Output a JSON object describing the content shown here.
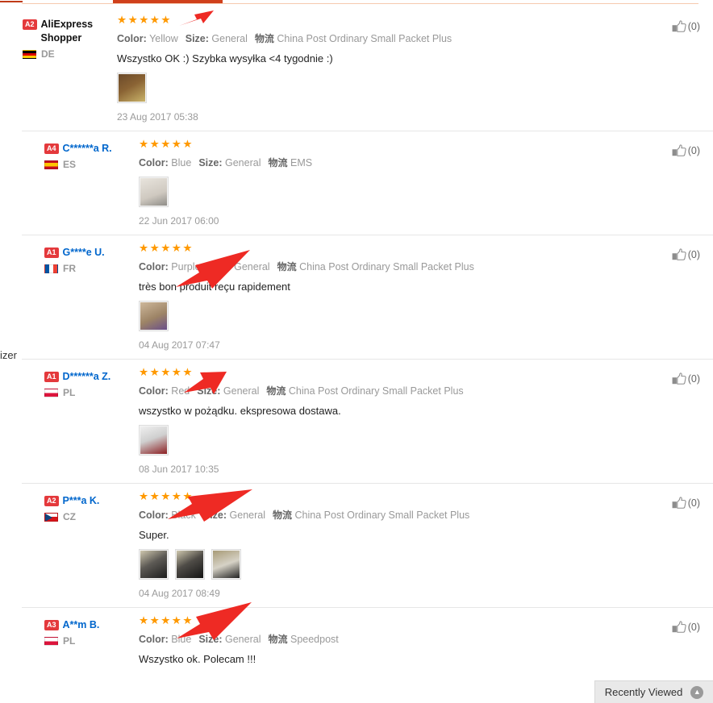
{
  "page": {
    "stray_text": "izer",
    "helpful_icon": "thumbs-up-icon"
  },
  "recently_viewed": {
    "label": "Recently Viewed",
    "chevron": "chevron-up-icon"
  },
  "attr_labels": {
    "color": "Color:",
    "size": "Size:",
    "logistics": "物流"
  },
  "reviews": [
    {
      "level": "A2",
      "name": "AliExpress Shopper",
      "name_color": "black",
      "country_code": "DE",
      "flag": "flag-de",
      "stars": "★★★★★",
      "rating": 5,
      "color": "Yellow",
      "size": "General",
      "shipping": "China Post Ordinary Small Packet Plus",
      "text": "Wszystko OK :) Szybka wysyłka <4 tygodnie :)",
      "date": "23 Aug 2017 05:38",
      "helpful_count": "(0)",
      "thumbs": [
        "yellow-shoes-photo"
      ]
    },
    {
      "level": "A4",
      "name": "C******a R.",
      "name_color": "blue",
      "country_code": "ES",
      "flag": "flag-es",
      "stars": "★★★★★",
      "rating": 5,
      "color": "Blue",
      "size": "General",
      "shipping": "EMS",
      "text": "",
      "date": "22 Jun 2017 06:00",
      "helpful_count": "(0)",
      "thumbs": [
        "blue-item-photo"
      ]
    },
    {
      "level": "A1",
      "name": "G****e U.",
      "name_color": "blue",
      "country_code": "FR",
      "flag": "flag-fr",
      "stars": "★★★★★",
      "rating": 5,
      "color": "Purple",
      "size": "General",
      "shipping": "China Post Ordinary Small Packet Plus",
      "text": "très bon produit reçu rapidement",
      "date": "04 Aug 2017 07:47",
      "helpful_count": "(0)",
      "thumbs": [
        "purple-item-photo"
      ]
    },
    {
      "level": "A1",
      "name": "D******a Z.",
      "name_color": "blue",
      "country_code": "PL",
      "flag": "flag-pl",
      "stars": "★★★★★",
      "rating": 5,
      "color": "Red",
      "size": "General",
      "shipping": "China Post Ordinary Small Packet Plus",
      "text": "wszystko w pożądku. ekspresowa dostawa.",
      "date": "08 Jun 2017 10:35",
      "helpful_count": "(0)",
      "thumbs": [
        "red-item-photo"
      ]
    },
    {
      "level": "A2",
      "name": "P***a K.",
      "name_color": "blue",
      "country_code": "CZ",
      "flag": "flag-cz",
      "stars": "★★★★★",
      "rating": 5,
      "color": "Black",
      "size": "General",
      "shipping": "China Post Ordinary Small Packet Plus",
      "text": "Super.",
      "date": "04 Aug 2017 08:49",
      "helpful_count": "(0)",
      "thumbs": [
        "black-item-photo-1",
        "black-item-photo-2",
        "black-item-photo-3"
      ]
    },
    {
      "level": "A3",
      "name": "A**m B.",
      "name_color": "blue",
      "country_code": "PL",
      "flag": "flag-pl",
      "stars": "★★★★★",
      "rating": 5,
      "color": "Blue",
      "size": "General",
      "shipping": "Speedpost",
      "text": "Wszystko ok. Polecam !!!",
      "date": "",
      "helpful_count": "(0)",
      "thumbs": []
    }
  ],
  "colors": {
    "star": "#ff9900",
    "accent": "#d0401b",
    "link": "#0066cc",
    "badge": "#e4393c",
    "annotation_arrow": "#ee2a24"
  }
}
